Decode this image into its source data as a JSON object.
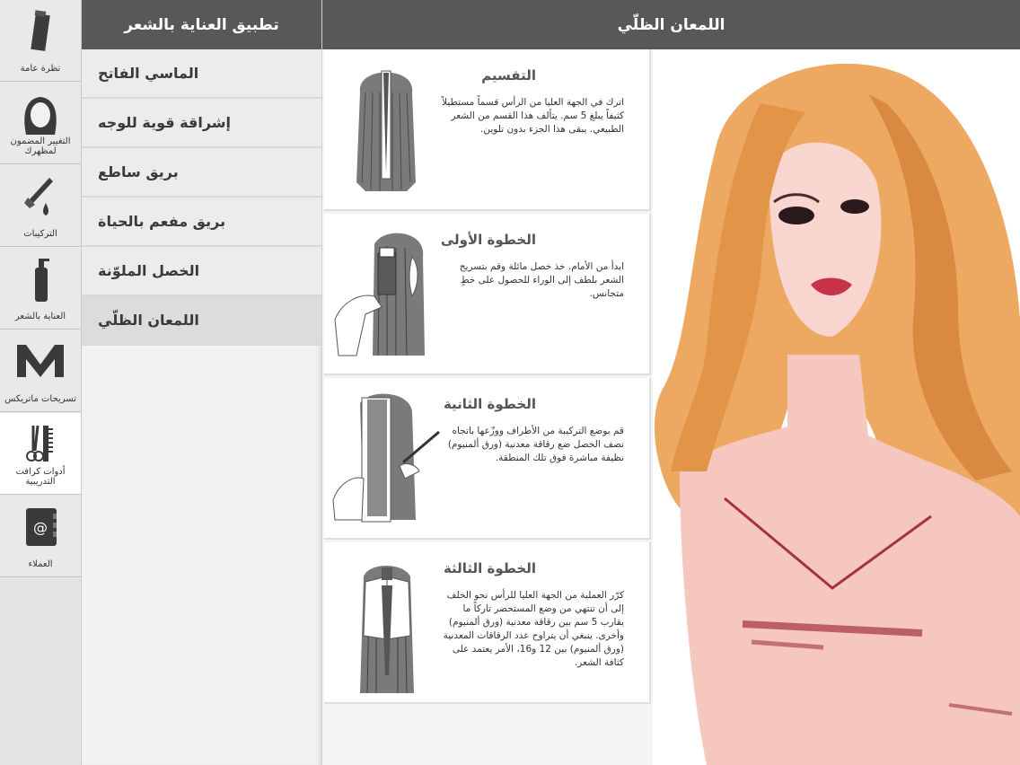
{
  "rail": [
    {
      "label": "نظرة عامة",
      "icon": "tube-icon"
    },
    {
      "label": "التغيير المضمون لمظهرك",
      "icon": "woman-head-icon"
    },
    {
      "label": "التركيبات",
      "icon": "brush-drop-icon"
    },
    {
      "label": "العناية بالشعر",
      "icon": "bottle-icon"
    },
    {
      "label": "تسريحات ماتريكس",
      "icon": "matrix-m-icon"
    },
    {
      "label": "أدوات كرافت التدريبية",
      "icon": "scissors-comb-icon"
    },
    {
      "label": "العملاء",
      "icon": "address-book-icon"
    }
  ],
  "menu": {
    "title": "تطبيق العناية بالشعر",
    "items": [
      {
        "label": "الماسي الفاتح"
      },
      {
        "label": "إشراقة قوية للوجه"
      },
      {
        "label": "بريق ساطع"
      },
      {
        "label": "بريق مفعم بالحياة"
      },
      {
        "label": "الخصل الملوّنة"
      },
      {
        "label": "اللمعان الظلّي"
      }
    ]
  },
  "main": {
    "title": "اللمعان الظلّي",
    "steps": [
      {
        "title": "التقسيم",
        "text": "اترك في الجهة العليا من الرأس قسماً مستطيلاً كثيفاً يبلغ 5 سم. يتألف هذا القسم من الشعر الطبيعي. يبقى هذا الجزء بدون تلوين."
      },
      {
        "title": "الخطوة الأولى",
        "text": "ابدأ من الأمام. خذ خصل مائلة وقم بتسريح الشعر بلطف إلى الوراء للحصول على خطٍ متجانس."
      },
      {
        "title": "الخطوة الثانية",
        "text": "قم بوضع التركيبة من الأطراف ووزّعها باتجاه نصف الخصل ضع رقاقة معدنية (ورق ألمنيوم) نظيفة مباشرة فوق تلك المنطقة."
      },
      {
        "title": "الخطوة الثالثة",
        "text": "كرّر العملية من الجهة العليا للرأس نحو الخلف إلى أن تنتهي من وضع المستحضر تاركاً ما يقارب 5 سم بين رقاقة معدنية (ورق ألمنيوم) وأخرى. ينبغي أن يتراوح عدد الرقاقات المعدنية (ورق ألمنيوم) بين 12 و16، الأمر يعتمد على كثافة الشعر."
      }
    ]
  },
  "colors": {
    "header": "#58585b",
    "hair": "#e8a25a",
    "skin": "#f6c6bf",
    "lips": "#c8324a"
  }
}
